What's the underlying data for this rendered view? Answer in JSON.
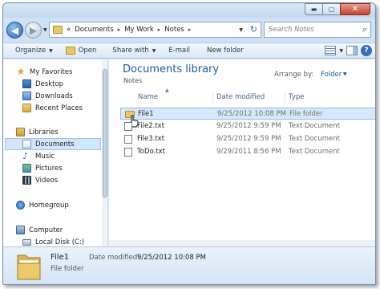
{
  "window": {
    "caption": {
      "minimize": "▬",
      "maximize": "▢",
      "close": "✕"
    }
  },
  "nav": {
    "back_glyph": "◀",
    "forward_glyph": "▶",
    "dropdown_glyph": "▼"
  },
  "address": {
    "overflow": "«",
    "crumbs": [
      "Documents",
      "My Work",
      "Notes"
    ],
    "separator": "▸",
    "refresh_glyph": "↻"
  },
  "search": {
    "placeholder": "Search Notes",
    "icon": "search-icon"
  },
  "toolbar": {
    "organize": "Organize",
    "open": "Open",
    "share_with": "Share with",
    "email": "E-mail",
    "new_folder": "New folder",
    "help": "?"
  },
  "sidebar": {
    "favorites": "My Favorites",
    "desktop": "Desktop",
    "downloads": "Downloads",
    "recent": "Recent Places",
    "libraries": "Libraries",
    "documents": "Documents",
    "music": "Music",
    "pictures": "Pictures",
    "videos": "Videos",
    "homegroup": "Homegroup",
    "computer": "Computer",
    "local_disk": "Local Disk (C:)"
  },
  "library": {
    "title": "Documents library",
    "subtitle": "Notes",
    "arrange_label": "Arrange by:",
    "arrange_value": "Folder"
  },
  "columns": {
    "name": "Name",
    "date": "Date modified",
    "type": "Type"
  },
  "files": [
    {
      "name": "File1",
      "date": "9/25/2012 10:08 PM",
      "type": "File folder",
      "icon": "folder-icon"
    },
    {
      "name": "File2.txt",
      "date": "9/25/2012 9:59 PM",
      "type": "Text Document",
      "icon": "text-file-icon"
    },
    {
      "name": "File3.txt",
      "date": "9/25/2012 9:59 PM",
      "type": "Text Document",
      "icon": "text-file-icon"
    },
    {
      "name": "ToDo.txt",
      "date": "9/29/2011 8:56 PM",
      "type": "Text Document",
      "icon": "text-file-icon"
    }
  ],
  "details": {
    "name": "File1",
    "date_label": "Date modified:",
    "date_value": "9/25/2012 10:08 PM",
    "type": "File folder"
  },
  "colors": {
    "accent": "#1e5c9c",
    "selection": "#d8e8fb",
    "frame": "#cfe1f4"
  }
}
